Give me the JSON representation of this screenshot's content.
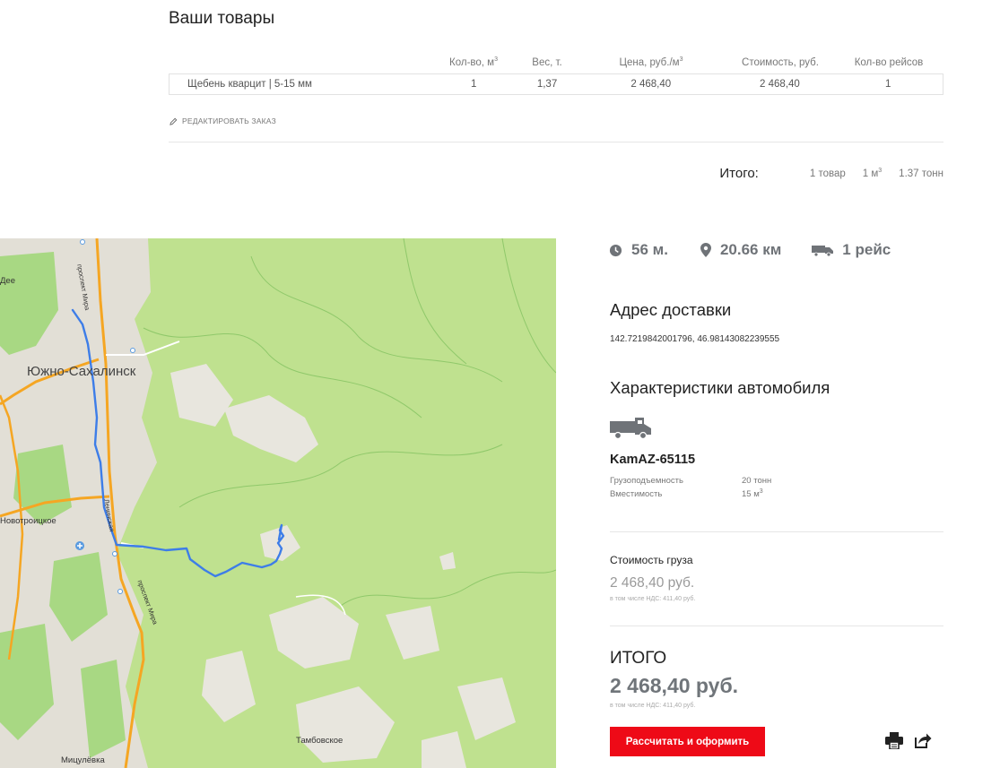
{
  "goods": {
    "title": "Ваши товары",
    "headers": {
      "qty": "Кол-во, м",
      "qty_sup": "3",
      "weight": "Вес, т.",
      "price": "Цена, руб./м",
      "price_sup": "3",
      "cost": "Стоимость, руб.",
      "trips": "Кол-во рейсов"
    },
    "rows": [
      {
        "name": "Щебень кварцит | 5-15 мм",
        "qty": "1",
        "weight": "1,37",
        "price": "2 468,40",
        "cost": "2 468,40",
        "trips": "1"
      }
    ],
    "edit_label": "РЕДАКТИРОВАТЬ ЗАКАЗ"
  },
  "summary": {
    "label": "Итого:",
    "items": "1 товар",
    "volume": "1 м",
    "volume_sup": "3",
    "weight": "1.37 тонн"
  },
  "map": {
    "city": "Южно-Сахалинск",
    "labels": [
      "Новотроицкое",
      "Тамбовское",
      "Мицулёвка",
      "Дее"
    ],
    "road_labels": [
      "проспект Мира",
      "Ленинская",
      "проспект Мира"
    ],
    "colors": {
      "land": "#bfe18f",
      "forest": "#9fd37a",
      "urban": "#e2dfd6",
      "road": "#f5a623",
      "route": "#3d7de8"
    }
  },
  "trip": {
    "time": "56 м.",
    "distance": "20.66 км",
    "trips": "1 рейс"
  },
  "address": {
    "title": "Адрес доставки",
    "value": "142.7219842001796, 46.98143082239555"
  },
  "vehicle": {
    "title": "Характеристики автомобиля",
    "model": "KamAZ-65115",
    "capacity_label": "Грузоподъемность",
    "capacity_value": "20 тонн",
    "volume_label": "Вместимость",
    "volume_value": "15 м",
    "volume_sup": "3"
  },
  "cost": {
    "label": "Стоимость груза",
    "value": "2 468,40 руб.",
    "vat": "в том числе НДС: 411,40 руб."
  },
  "total": {
    "label": "ИТОГО",
    "value": "2 468,40 руб.",
    "vat": "в том числе НДС: 411,40 руб."
  },
  "actions": {
    "submit": "Рассчитать и оформить",
    "print_icon": "printer-icon",
    "share_icon": "share-icon"
  },
  "colors": {
    "accent": "#ee0a17",
    "muted": "#70757a"
  }
}
